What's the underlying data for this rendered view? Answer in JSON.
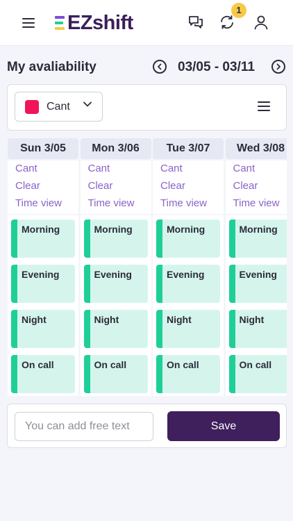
{
  "app": {
    "logo_text": "EZshift",
    "notification_count": "1"
  },
  "colors": {
    "brand_purple": "#3f1f5c",
    "cant_color": "#f0145a",
    "link_purple": "#8a63c8",
    "slot_fill": "#d5f5ec",
    "slot_accent": "#1fcf98",
    "badge_yellow": "#f7c948",
    "logo_bars": [
      "#7a4fd6",
      "#1fcf98",
      "#f7c948"
    ]
  },
  "icons": {
    "menu": "hamburger-menu-icon",
    "chat": "chat-bubbles-icon",
    "sync": "sync-arrows-icon",
    "user": "user-profile-icon",
    "prev": "chevron-left-circle-icon",
    "next": "chevron-right-circle-icon",
    "dropdown": "chevron-down-icon",
    "list": "list-menu-icon"
  },
  "page": {
    "title": "My avaliability",
    "week_range": "03/05 - 03/11"
  },
  "filter": {
    "selected": "Cant"
  },
  "days": [
    {
      "label": "Sun 3/05",
      "cant": "Cant",
      "clear": "Clear",
      "time_view": "Time view",
      "slots": [
        "Morning",
        "Evening",
        "Night",
        "On call"
      ]
    },
    {
      "label": "Mon 3/06",
      "cant": "Cant",
      "clear": "Clear",
      "time_view": "Time view",
      "slots": [
        "Morning",
        "Evening",
        "Night",
        "On call"
      ]
    },
    {
      "label": "Tue 3/07",
      "cant": "Cant",
      "clear": "Clear",
      "time_view": "Time view",
      "slots": [
        "Morning",
        "Evening",
        "Night",
        "On call"
      ]
    },
    {
      "label": "Wed 3/08",
      "cant": "Cant",
      "clear": "Clear",
      "time_view": "Time view",
      "slots": [
        "Morning",
        "Evening",
        "Night",
        "On call"
      ]
    }
  ],
  "footer": {
    "free_text_placeholder": "You can add free text",
    "free_text_value": "",
    "save_label": "Save"
  }
}
